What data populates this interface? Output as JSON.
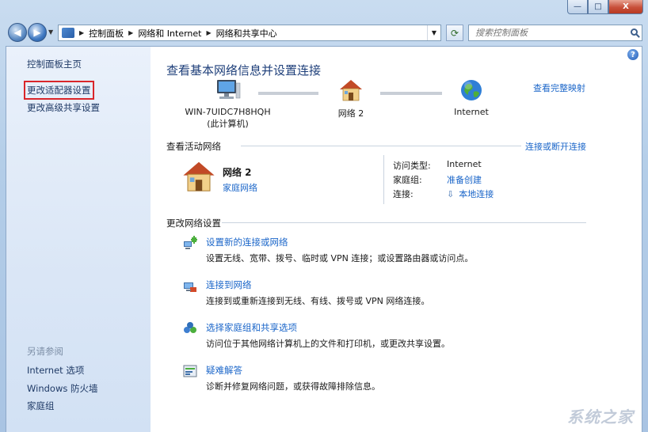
{
  "window": {
    "caption": {
      "minimize": "—",
      "maximize": "□",
      "close": "X"
    }
  },
  "navbar": {
    "back_glyph": "◀",
    "forward_glyph": "▶",
    "breadcrumbs": [
      "控制面板",
      "网络和 Internet",
      "网络和共享中心"
    ],
    "search_placeholder": "搜索控制面板"
  },
  "sidebar": {
    "items": [
      {
        "label": "控制面板主页"
      },
      {
        "label": "更改适配器设置",
        "highlighted": true
      },
      {
        "label": "更改高级共享设置"
      }
    ],
    "see_also_label": "另请参阅",
    "see_also_items": [
      {
        "label": "Internet 选项"
      },
      {
        "label": "Windows 防火墙"
      },
      {
        "label": "家庭组"
      }
    ]
  },
  "main": {
    "title": "查看基本网络信息并设置连接",
    "map_link": "查看完整映射",
    "nodes": {
      "computer": {
        "name": "WIN-7UIDC7H8HQH",
        "sub": "(此计算机)",
        "icon": "computer-icon"
      },
      "network": {
        "name": "网络  2",
        "icon": "house-icon"
      },
      "internet": {
        "name": "Internet",
        "icon": "globe-icon"
      }
    },
    "active_networks": {
      "header": "查看活动网络",
      "link": "连接或断开连接",
      "network_name": "网络  2",
      "network_category": "家庭网络",
      "access_type_key": "访问类型:",
      "access_type_value": "Internet",
      "homegroup_key": "家庭组:",
      "homegroup_value": "准备创建",
      "connections_key": "连接:",
      "connections_value": "本地连接"
    },
    "settings": {
      "header": "更改网络设置",
      "tasks": [
        {
          "title": "设置新的连接或网络",
          "desc": "设置无线、宽带、拨号、临时或 VPN 连接；或设置路由器或访问点。",
          "icon": "new-connection-icon"
        },
        {
          "title": "连接到网络",
          "desc": "连接到或重新连接到无线、有线、拨号或 VPN 网络连接。",
          "icon": "connect-network-icon"
        },
        {
          "title": "选择家庭组和共享选项",
          "desc": "访问位于其他网络计算机上的文件和打印机，或更改共享设置。",
          "icon": "homegroup-icon"
        },
        {
          "title": "疑难解答",
          "desc": "诊断并修复网络问题，或获得故障排除信息。",
          "icon": "troubleshoot-icon"
        }
      ]
    }
  },
  "watermark": "系统之家",
  "colors": {
    "link": "#1b66c9",
    "title": "#1e3f7a",
    "highlight_box": "#d9262a"
  }
}
